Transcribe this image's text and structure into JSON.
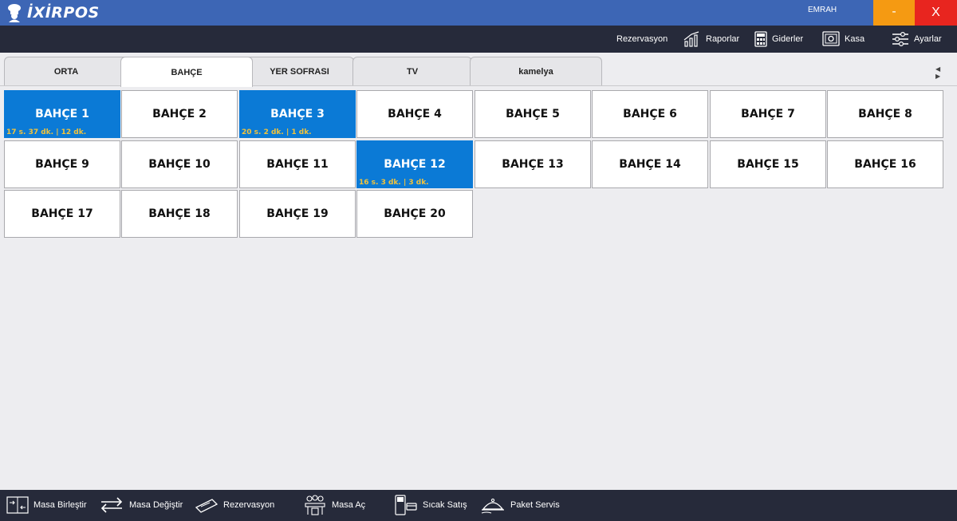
{
  "app": {
    "logo_text": "İXİRPOS",
    "user": "EMRAH",
    "minimize_label": "-",
    "close_label": "X"
  },
  "nav": {
    "rezervasyon": "Rezervasyon",
    "raporlar": "Raporlar",
    "giderler": "Giderler",
    "kasa": "Kasa",
    "ayarlar": "Ayarlar"
  },
  "tabs": [
    {
      "label": "ORTA"
    },
    {
      "label": "BAHÇE",
      "active": true
    },
    {
      "label": "YER SOFRASI"
    },
    {
      "label": "TV"
    },
    {
      "label": "kamelya"
    }
  ],
  "tab_scroll": "◀ ▶",
  "tables": [
    {
      "name": "BAHÇE 1",
      "occupied": true,
      "info": "17 s. 37 dk.  |  12 dk."
    },
    {
      "name": "BAHÇE 2"
    },
    {
      "name": "BAHÇE 3",
      "occupied": true,
      "info": "20 s. 2 dk.  |  1 dk."
    },
    {
      "name": "BAHÇE 4"
    },
    {
      "name": "BAHÇE 5"
    },
    {
      "name": "BAHÇE 6"
    },
    {
      "name": "BAHÇE 7"
    },
    {
      "name": "BAHÇE 8"
    },
    {
      "name": "BAHÇE 9"
    },
    {
      "name": "BAHÇE 10"
    },
    {
      "name": "BAHÇE 11"
    },
    {
      "name": "BAHÇE 12",
      "occupied": true,
      "info": "16 s. 3 dk.  |  3 dk."
    },
    {
      "name": "BAHÇE 13"
    },
    {
      "name": "BAHÇE 14"
    },
    {
      "name": "BAHÇE 15"
    },
    {
      "name": "BAHÇE 16"
    },
    {
      "name": "BAHÇE 17"
    },
    {
      "name": "BAHÇE 18"
    },
    {
      "name": "BAHÇE 19"
    },
    {
      "name": "BAHÇE 20"
    }
  ],
  "bottom": {
    "masa_birlestir": "Masa Birleştir",
    "masa_degistir": "Masa Değiştir",
    "rezervasyon": "Rezervasyon",
    "masa_ac": "Masa Aç",
    "sicak_satis": "Sıcak Satış",
    "paket_servis": "Paket Servis"
  },
  "colors": {
    "titlebar": "#3d66b5",
    "navbar": "#262a3a",
    "occupied": "#0b7ad6",
    "info_text": "#f3c33a",
    "minimize": "#f59a12",
    "close": "#e8251f"
  }
}
